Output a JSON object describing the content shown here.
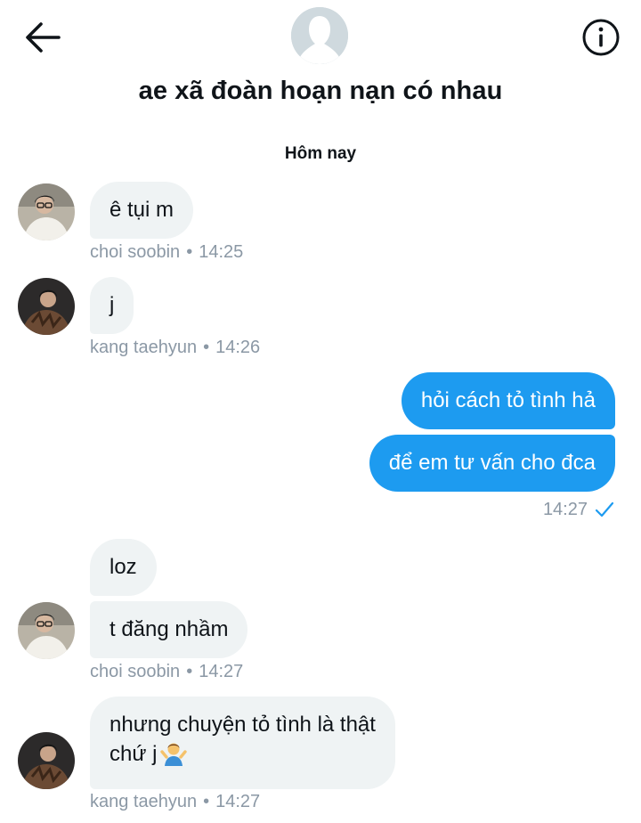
{
  "header": {
    "title": "ae xã đoàn hoạn nạn có nhau",
    "back_icon": "back-arrow-icon",
    "info_icon": "info-icon"
  },
  "day_separator": "Hôm nay",
  "colors": {
    "outgoing_bubble": "#1d9bf0",
    "incoming_bubble": "#eff3f4",
    "meta_text": "#8b98a5",
    "read_check": "#1d9bf0"
  },
  "messages": [
    {
      "text": "ê tụi m",
      "direction": "incoming",
      "sender": "choi soobin",
      "time": "14:25"
    },
    {
      "text": "j",
      "direction": "incoming",
      "sender": "kang taehyun",
      "time": "14:26"
    },
    {
      "text": "hỏi cách tỏ tình hả",
      "direction": "outgoing"
    },
    {
      "text": "để em tư vấn cho đca",
      "direction": "outgoing",
      "time": "14:27",
      "status_icon": "read-check-icon"
    },
    {
      "text": "loz",
      "direction": "incoming"
    },
    {
      "text": "t đăng nhầm",
      "direction": "incoming",
      "sender": "choi soobin",
      "time": "14:27"
    },
    {
      "text_line1": "nhưng chuyện tỏ tình là thật",
      "text_line2": "chứ j",
      "emoji": "person-shrugging-emoji",
      "direction": "incoming",
      "sender": "kang taehyun",
      "time": "14:27"
    }
  ],
  "meta_separator": "•"
}
